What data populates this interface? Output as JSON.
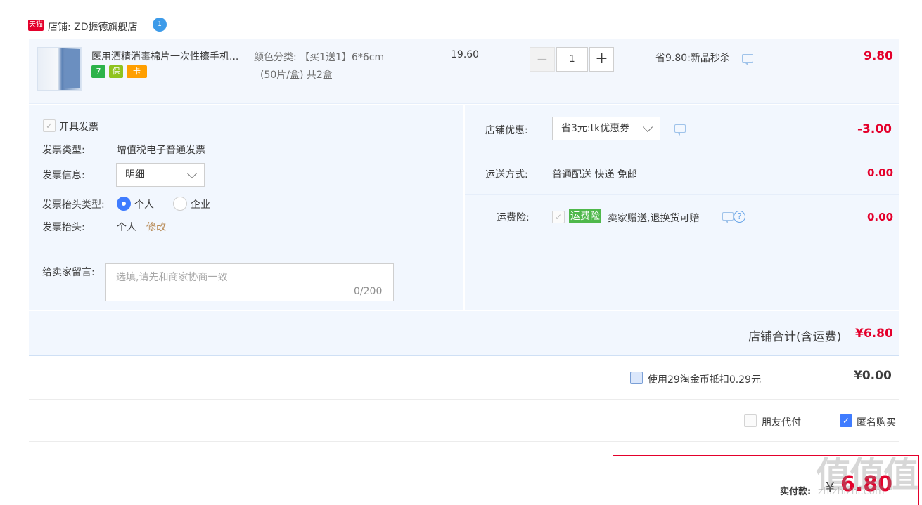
{
  "shop": {
    "badge": "天猫",
    "label": "店铺: ZD振德旗舰店",
    "wangwang_badge": "1"
  },
  "item": {
    "title": "医用酒精消毒棉片一次性擦手机...",
    "service_icons": [
      "7",
      "保",
      "卡"
    ],
    "sku_line1": "颜色分类: 【买1送1】6*6cm",
    "sku_line2": "(50片/盒) 共2盒",
    "unit_price": "19.60",
    "qty_minus": "−",
    "quantity": "1",
    "qty_plus": "+",
    "promo": "省9.80:新品秒杀",
    "total": "9.80"
  },
  "invoice": {
    "issue_label": "开具发票",
    "type_label": "发票类型:",
    "type_value": "增值税电子普通发票",
    "info_label": "发票信息:",
    "info_value": "明细",
    "header_type_label": "发票抬头类型:",
    "option_personal": "个人",
    "option_company": "企业",
    "header_label": "发票抬头:",
    "header_value": "个人",
    "edit_link": "修改"
  },
  "message": {
    "label": "给卖家留言:",
    "placeholder": "选填,请先和商家协商一致",
    "count": "0/200"
  },
  "shop_discount": {
    "label": "店铺优惠:",
    "value": "省3元:tk优惠券",
    "amount": "-3.00"
  },
  "shipping": {
    "label": "运送方式:",
    "value": "普通配送 快递 免邮",
    "amount": "0.00"
  },
  "insurance": {
    "label": "运费险:",
    "badge": "运费险",
    "text": "卖家赠送,退换货可赔",
    "help": "?",
    "amount": "0.00"
  },
  "summary": {
    "label": "店铺合计(含运费)",
    "amount": "¥6.80"
  },
  "coins": {
    "label": "使用29淘金币抵扣0.29元",
    "amount": "¥0.00"
  },
  "options": {
    "friend_pay": "朋友代付",
    "anonymous": "匿名购买"
  },
  "payment": {
    "label": "实付款:",
    "currency": "¥",
    "amount": "6.80"
  },
  "watermark": {
    "logo": "值值值",
    "site": "zhizhizhi.com"
  },
  "colors": {
    "accent_red": "#e4002b",
    "panel_blue": "#f2f7fe",
    "checkbox_blue": "#3f7cff",
    "insurance_green": "#4fb84b"
  }
}
